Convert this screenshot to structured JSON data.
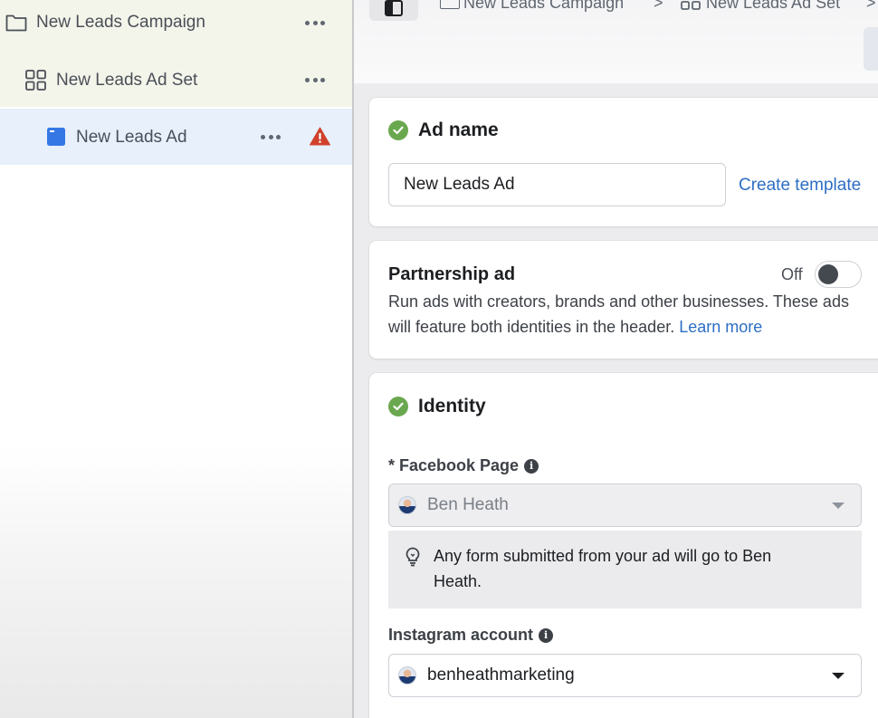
{
  "sidebar": {
    "items": [
      {
        "label": "New Leads Campaign",
        "icon": "folder-icon"
      },
      {
        "label": "New Leads Ad Set",
        "icon": "grid-icon"
      },
      {
        "label": "New Leads Ad",
        "icon": "ad-icon",
        "warning_icon": "warning-icon"
      }
    ]
  },
  "breadcrumb": {
    "items": [
      "New Leads Campaign",
      "New Leads Ad Set"
    ],
    "separator": ">"
  },
  "ad_name_card": {
    "title": "Ad name",
    "input_value": "New Leads Ad",
    "create_template_label": "Create template"
  },
  "partnership_card": {
    "title": "Partnership ad",
    "toggle_label": "Off",
    "description": "Run ads with creators, brands and other businesses. These ads will feature both identities in the header.",
    "learn_more_label": "Learn more"
  },
  "identity_card": {
    "title": "Identity",
    "facebook_page_label": "* Facebook Page",
    "facebook_page_value": "Ben Heath",
    "notice_text": "Any form submitted from your ad will go to Ben Heath.",
    "instagram_label": "Instagram account",
    "instagram_value": "benheathmarketing"
  },
  "colors": {
    "accent_link": "#2d6ec4",
    "success_green": "#6aa84f",
    "warning_red": "#d0412b",
    "ad_icon_blue": "#3578e5",
    "selected_row": "#e7f0fb"
  }
}
